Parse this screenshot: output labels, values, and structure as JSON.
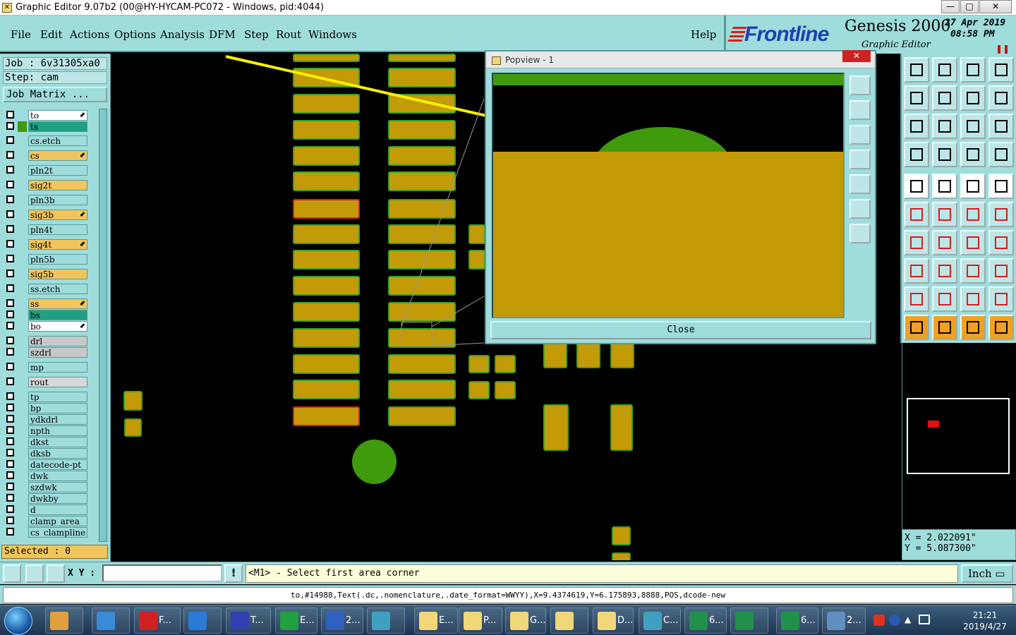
{
  "window": {
    "title": "Graphic Editor 9.07b2 (00@HY-HYCAM-PC072 - Windows, pid:4044)",
    "minimize": "—",
    "maximize": "□",
    "close": "✕"
  },
  "menu": {
    "items": [
      "File",
      "Edit",
      "Actions",
      "Options",
      "Analysis",
      "DFM",
      "Step",
      "Rout",
      "Windows"
    ],
    "help": "Help"
  },
  "brand": {
    "logo": "Frontline",
    "product": "Genesis 2000",
    "subtitle": "Graphic Editor",
    "date": "27 Apr 2019",
    "time": "08:58 PM"
  },
  "job": {
    "job_line": "Job : 6v31305xa0",
    "step_line": "Step: cam",
    "matrix_button": "Job Matrix ..."
  },
  "layers": [
    {
      "name": "to",
      "color": "#ffffff",
      "mark": "",
      "arrow": true
    },
    {
      "name": "ts",
      "color": "#20a080",
      "mark": "#3f9a0c",
      "arrow": false
    },
    {
      "name": "cs.etch",
      "color": "#9fdcdc",
      "mark": "",
      "arrow": false
    },
    {
      "name": "cs",
      "color": "#f2c55c",
      "mark": "",
      "arrow": true
    },
    {
      "name": "pln2t",
      "color": "#9fdcdc",
      "mark": "",
      "arrow": false
    },
    {
      "name": "sig2t",
      "color": "#f2c55c",
      "mark": "",
      "arrow": false
    },
    {
      "name": "pln3b",
      "color": "#9fdcdc",
      "mark": "",
      "arrow": false
    },
    {
      "name": "sig3b",
      "color": "#f2c55c",
      "mark": "",
      "arrow": true
    },
    {
      "name": "pln4t",
      "color": "#9fdcdc",
      "mark": "",
      "arrow": false
    },
    {
      "name": "sig4t",
      "color": "#f2c55c",
      "mark": "",
      "arrow": true
    },
    {
      "name": "pln5b",
      "color": "#9fdcdc",
      "mark": "",
      "arrow": false
    },
    {
      "name": "sig5b",
      "color": "#f2c55c",
      "mark": "",
      "arrow": false
    },
    {
      "name": "ss.etch",
      "color": "#9fdcdc",
      "mark": "",
      "arrow": false
    },
    {
      "name": "ss",
      "color": "#f2c55c",
      "mark": "",
      "arrow": true
    },
    {
      "name": "bs",
      "color": "#20a080",
      "mark": "",
      "arrow": false
    },
    {
      "name": "bo",
      "color": "#ffffff",
      "mark": "",
      "arrow": true
    },
    {
      "name": "drl",
      "color": "#c8c8c8",
      "mark": "",
      "arrow": false
    },
    {
      "name": "szdrl",
      "color": "#c8c8c8",
      "mark": "",
      "arrow": false
    },
    {
      "name": "mp",
      "color": "#9fdcdc",
      "mark": "",
      "arrow": false
    },
    {
      "name": "rout",
      "color": "#d8d8d8",
      "mark": "",
      "arrow": false
    },
    {
      "name": "tp",
      "color": "#9fdcdc",
      "mark": "",
      "arrow": false
    },
    {
      "name": "bp",
      "color": "#9fdcdc",
      "mark": "",
      "arrow": false
    },
    {
      "name": "ydkdrl",
      "color": "#9fdcdc",
      "mark": "",
      "arrow": false
    },
    {
      "name": "npth",
      "color": "#9fdcdc",
      "mark": "",
      "arrow": false
    },
    {
      "name": "dkst",
      "color": "#9fdcdc",
      "mark": "",
      "arrow": false
    },
    {
      "name": "dksb",
      "color": "#9fdcdc",
      "mark": "",
      "arrow": false
    },
    {
      "name": "datecode-pt",
      "color": "#9fdcdc",
      "mark": "",
      "arrow": false
    },
    {
      "name": "dwk",
      "color": "#9fdcdc",
      "mark": "",
      "arrow": false
    },
    {
      "name": "szdwk",
      "color": "#9fdcdc",
      "mark": "",
      "arrow": false
    },
    {
      "name": "dwkby",
      "color": "#9fdcdc",
      "mark": "",
      "arrow": false
    },
    {
      "name": "d",
      "color": "#9fdcdc",
      "mark": "",
      "arrow": false
    },
    {
      "name": "clamp_area",
      "color": "#9fdcdc",
      "mark": "",
      "arrow": false
    },
    {
      "name": "cs_clampline",
      "color": "#9fdcdc",
      "mark": "",
      "arrow": false
    }
  ],
  "selected": "Selected : 0",
  "popview": {
    "title": "Popview - 1",
    "close_x": "✕",
    "close_button": "Close"
  },
  "coords": {
    "x": "X = 2.022091\"",
    "y": "Y = 5.087300\""
  },
  "command": {
    "xy_label": "X Y :",
    "xy_value": "",
    "warn": "!",
    "prompt": "<M1> - Select first area corner",
    "units": "Inch ▭"
  },
  "info": "to,#14988,Text(.dc,.nomenclature,.date_format=WWYY),X=9.4374619,Y=6.175893,8888,POS,dcode-new",
  "taskbar": {
    "items": [
      {
        "label": "",
        "color": "#e0a040"
      },
      {
        "label": "",
        "color": "#3a8ad8"
      },
      {
        "label": "F...",
        "color": "#d02020"
      },
      {
        "label": "",
        "color": "#2a7ad8"
      },
      {
        "label": "T...",
        "color": "#3040b0"
      },
      {
        "label": "E...",
        "color": "#20a040"
      },
      {
        "label": "2...",
        "color": "#3060c0"
      },
      {
        "label": "",
        "color": "#40a0c0"
      },
      {
        "label": "E...",
        "color": "#f2d67a"
      },
      {
        "label": "P...",
        "color": "#f2d67a"
      },
      {
        "label": "G...",
        "color": "#f2d67a"
      },
      {
        "label": "",
        "color": "#f2d67a"
      },
      {
        "label": "D...",
        "color": "#f2d67a"
      },
      {
        "label": "C...",
        "color": "#40a0c0"
      },
      {
        "label": "6...",
        "color": "#20904a"
      },
      {
        "label": "",
        "color": "#20904a"
      },
      {
        "label": "6...",
        "color": "#20904a"
      },
      {
        "label": "2...",
        "color": "#6090c0"
      }
    ],
    "time": "21:21",
    "date": "2019/4/27"
  }
}
